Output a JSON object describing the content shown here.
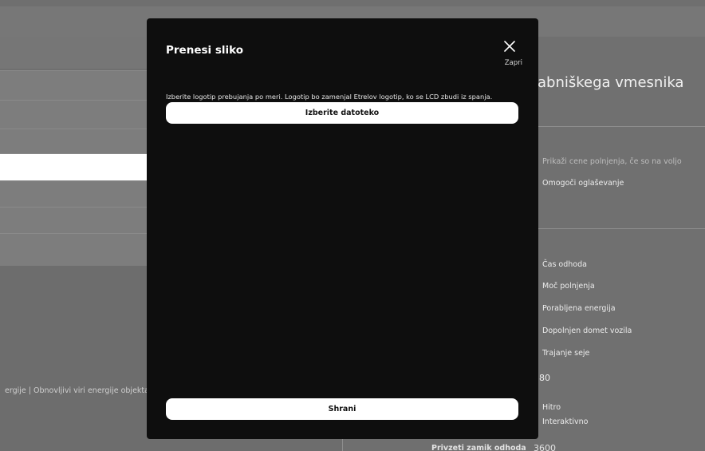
{
  "background": {
    "right_panel": {
      "title": "abniškega vmesnika",
      "items_top": [
        "Prikaži cene polnjenja, če so na voljo",
        "Omogoči oglaševanje"
      ],
      "items_list": [
        "Čas odhoda",
        "Moč polnjenja",
        "Porabljena energija",
        "Dopolnjen domet vozila",
        "Trajanje seje"
      ],
      "value_80": "80",
      "items_bottom": [
        "Hitro",
        "Interaktivno"
      ]
    },
    "footer_text": "ergije  |  Obnovljivi viri energije objekta",
    "bottom_field": {
      "label": "Privzeti zamik odhoda",
      "value": "3600"
    }
  },
  "modal": {
    "title": "Prenesi sliko",
    "close_label": "Zapri",
    "description": "Izberite logotip prebujanja po meri. Logotip bo zamenjal Etrelov logotip, ko se LCD zbudi iz spanja.",
    "choose_file_label": "Izberite datoteko",
    "save_label": "Shrani"
  }
}
